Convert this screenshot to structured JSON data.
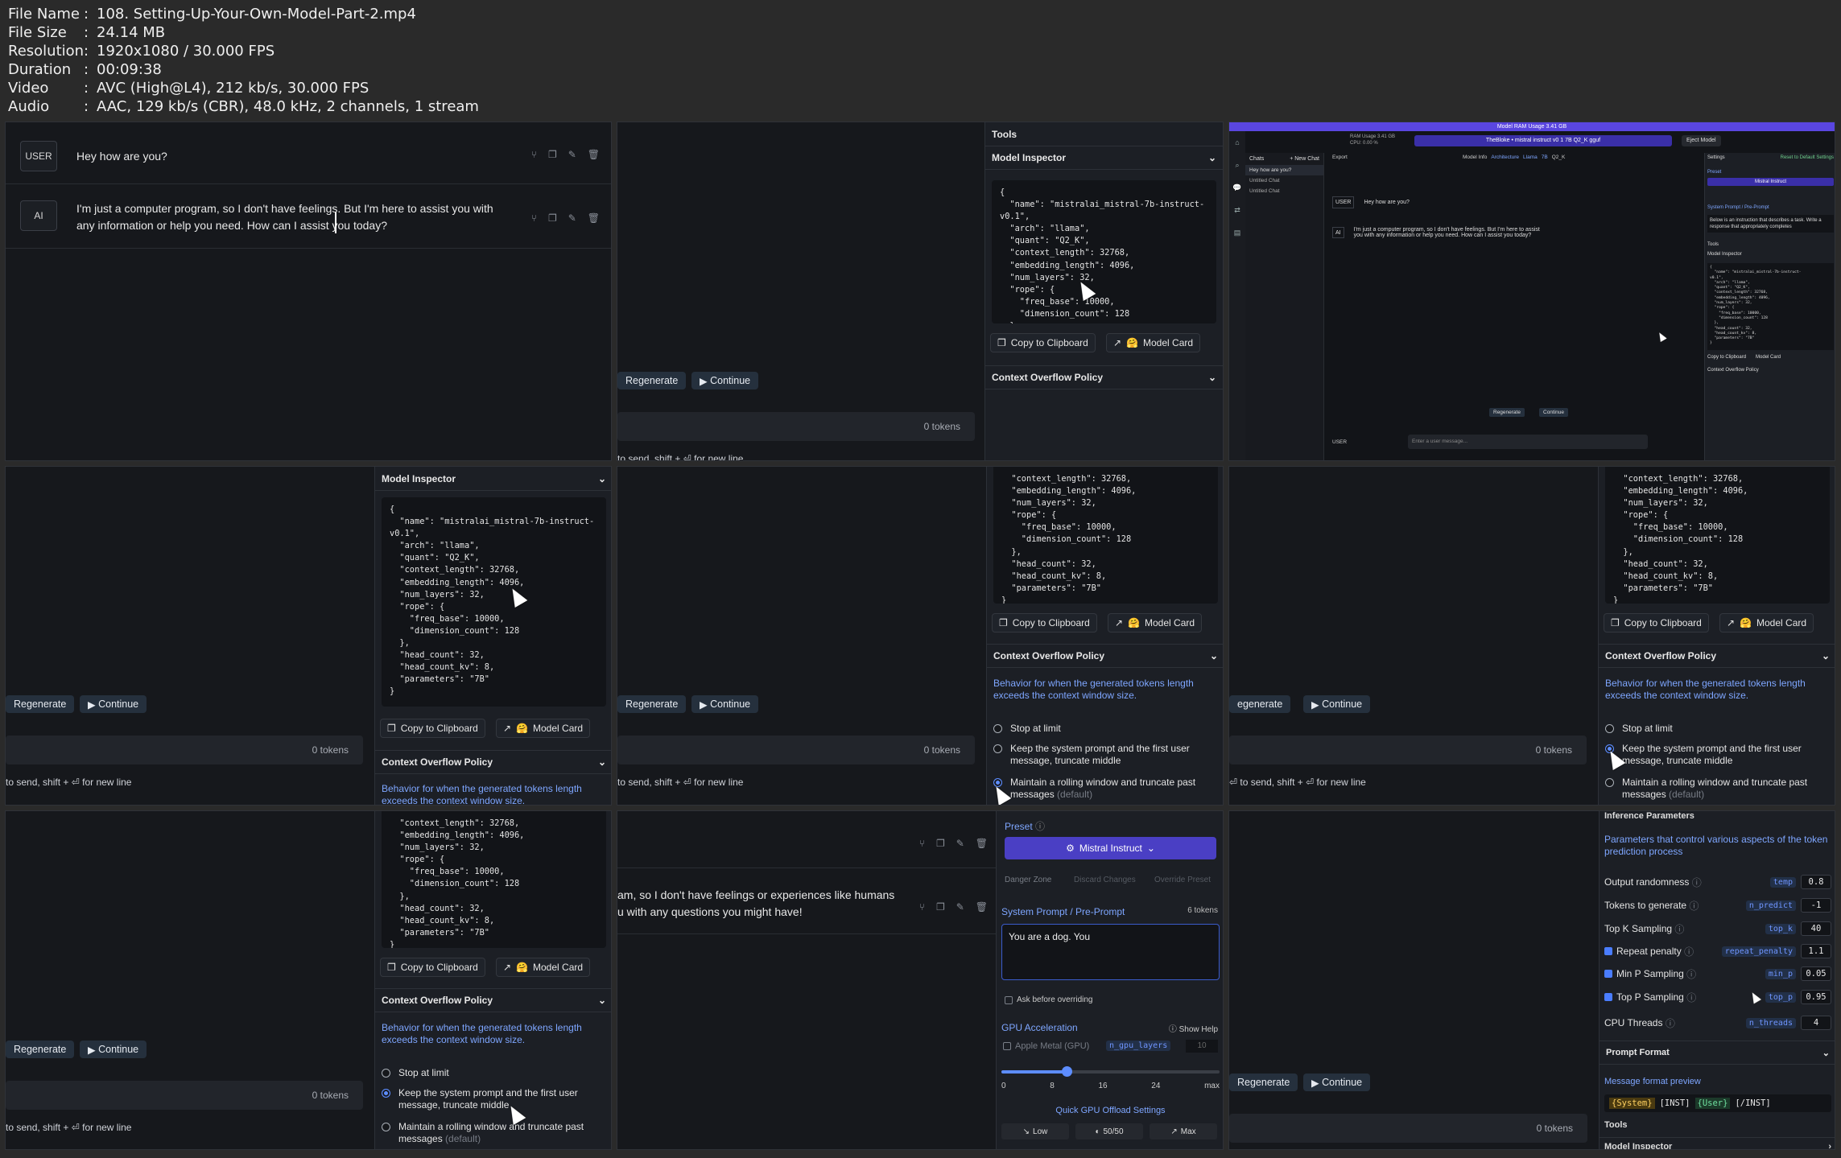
{
  "meta": {
    "rows": [
      {
        "key": "File Name",
        "value": "108. Setting-Up-Your-Own-Model-Part-2.mp4"
      },
      {
        "key": "File Size",
        "value": "24.14 MB"
      },
      {
        "key": "Resolution",
        "value": "1920x1080 / 30.000 FPS"
      },
      {
        "key": "Duration",
        "value": "00:09:38"
      },
      {
        "key": "Video",
        "value": "AVC (High@L4), 212 kb/s, 30.000 FPS"
      },
      {
        "key": "Audio",
        "value": "AAC, 129 kb/s (CBR), 48.0 kHz, 2 channels, 1 stream"
      }
    ]
  },
  "chat": {
    "user_role": "USER",
    "ai_role": "AI",
    "user_message": "Hey how are you?",
    "ai_message": "I'm just a computer program, so I don't have feelings. But I'm here to assist you with any information or help you need. How can I assist you today?",
    "ai_message_partial_1": "am, so I don't have feelings or experiences like humans",
    "ai_message_partial_2": "u with any questions you might have!",
    "regenerate": "Regenerate",
    "regenerate_cut": "egenerate",
    "continue": "Continue",
    "tokens": "0 tokens",
    "hint": "to send, shift + ⏎ for new line",
    "hint_cut": "⏎ to send, shift + ⏎ for new line"
  },
  "tools": {
    "title": "Tools",
    "model_inspector": "Model Inspector",
    "model_json": "{\n  \"name\": \"mistralai_mistral-7b-instruct-\nv0.1\",\n  \"arch\": \"llama\",\n  \"quant\": \"Q2_K\",\n  \"context_length\": 32768,\n  \"embedding_length\": 4096,\n  \"num_layers\": 32,\n  \"rope\": {\n    \"freq_base\": 10000,\n    \"dimension_count\": 128\n  },\n  \"head_count\": 32,\n  \"head_count_kv\": 8,\n  \"parameters\": \"7B\"\n}",
    "model_json_tail": "  \"context_length\": 32768,\n  \"embedding_length\": 4096,\n  \"num_layers\": 32,\n  \"rope\": {\n    \"freq_base\": 10000,\n    \"dimension_count\": 128\n  },\n  \"head_count\": 32,\n  \"head_count_kv\": 8,\n  \"parameters\": \"7B\"\n}",
    "copy": "Copy to Clipboard",
    "model_card": "Model Card",
    "overflow_title": "Context Overflow Policy",
    "overflow_desc": "Behavior for when the generated tokens length exceeds the context window size.",
    "opt_stop": "Stop at limit",
    "opt_keep": "Keep the system prompt and the first user message, truncate middle",
    "opt_rolling": "Maintain a rolling window and truncate past messages",
    "opt_default": "(default)"
  },
  "lmstudio": {
    "title_bar": "Model RAM Usage  3.41 GB",
    "ram": "RAM Usage  3.41 GB",
    "cpu": "CPU:  0.00 %",
    "model_selector": "TheBloke • mistral instruct v0 1 7B Q2_K gguf",
    "eject": "Eject Model",
    "chats": "Chats",
    "new_chat": "+ New Chat",
    "chat_items": [
      "Hey how are you?",
      "Untitled Chat",
      "Untitled Chat"
    ],
    "export": "Export",
    "model_info": "Model Info",
    "arch_tag": "Architecture",
    "llama_tag": "Llama",
    "size_tag": "7B",
    "quant_tag": "Q2_K",
    "settings": "Settings",
    "reset": "Reset to Default Settings",
    "preset": "Preset",
    "preset_value": "Mistral Instruct",
    "system_prompt": "System Prompt / Pre-Prompt",
    "system_text": "Below is an instruction that describes a task. Write a response that appropriately completes",
    "input_placeholder": "Enter a user message..."
  },
  "settings": {
    "preset": "Preset",
    "preset_value": "Mistral Instruct",
    "danger_zone": "Danger Zone",
    "discard": "Discard Changes",
    "override": "Override Preset",
    "system_prompt": "System Prompt / Pre-Prompt",
    "system_tokens": "6 tokens",
    "system_text": "You are a dog. You",
    "ask_before": "Ask before overriding",
    "gpu": "GPU Acceleration",
    "show_help": "Show Help",
    "apple_metal": "Apple Metal (GPU)",
    "gpu_tag": "n_gpu_layers",
    "gpu_val": "10",
    "ticks": [
      "0",
      "8",
      "16",
      "24",
      "max"
    ],
    "slider_fraction": 0.3,
    "quick": "Quick GPU Offload Settings",
    "low": "Low",
    "half": "50/50",
    "max": "Max"
  },
  "inference": {
    "title": "Inference Parameters",
    "desc": "Parameters that control various aspects of the token prediction process",
    "params": [
      {
        "label": "Output randomness",
        "tag": "temp",
        "value": "0.8",
        "check": "none"
      },
      {
        "label": "Tokens to generate",
        "tag": "n_predict",
        "value": "-1",
        "check": "none"
      },
      {
        "label": "Top K Sampling",
        "tag": "top_k",
        "value": "40",
        "check": "none"
      },
      {
        "label": "Repeat penalty",
        "tag": "repeat_penalty",
        "value": "1.1",
        "check": "on"
      },
      {
        "label": "Min P Sampling",
        "tag": "min_p",
        "value": "0.05",
        "check": "on"
      },
      {
        "label": "Top P Sampling",
        "tag": "top_p",
        "value": "0.95",
        "check": "on"
      },
      {
        "label": "CPU Threads",
        "tag": "n_threads",
        "value": "4",
        "check": "none"
      }
    ],
    "prompt_format": "Prompt Format",
    "preview": "Message format preview",
    "preview_system": "{System}",
    "preview_inst": "[INST]",
    "preview_user": "{User}",
    "preview_end": "[/INST]",
    "tools": "Tools",
    "model_inspector": "Model Inspector"
  },
  "colors": {
    "accent": "#5d8dff",
    "preset": "#4a3fc4",
    "desc": "#7ea6ff"
  }
}
